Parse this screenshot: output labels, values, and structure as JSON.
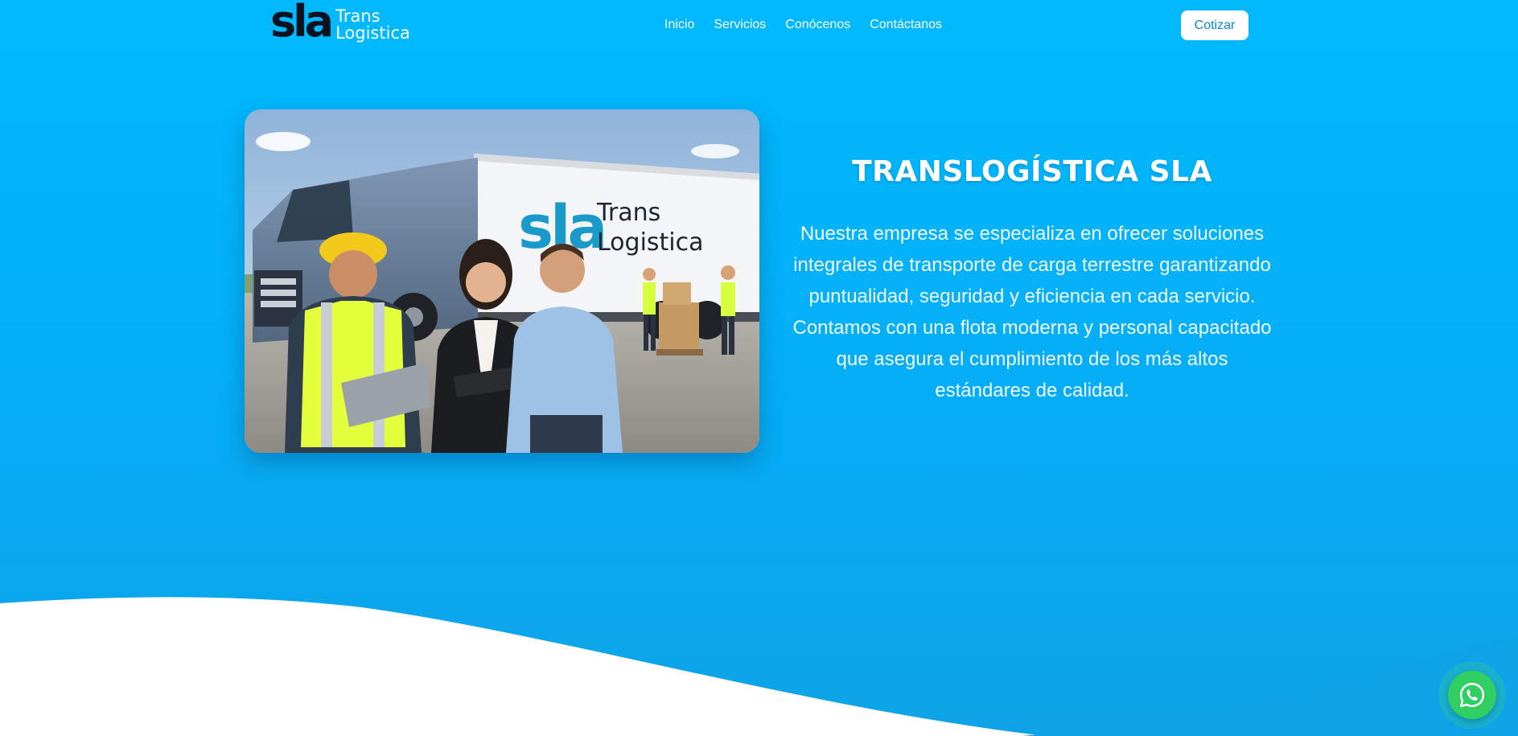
{
  "brand": {
    "logo_mark": "sla",
    "logo_word_1": "Trans",
    "logo_word_2": "Logistica"
  },
  "nav": {
    "items": [
      {
        "label": "Inicio"
      },
      {
        "label": "Servicios"
      },
      {
        "label": "Conócenos"
      },
      {
        "label": "Contáctanos"
      }
    ],
    "cta_label": "Cotizar"
  },
  "hero": {
    "title": "TRANSLOGÍSTICA SLA",
    "paragraph": "Nuestra empresa se especializa en ofrecer soluciones integrales de transporte de carga terrestre garantizando puntualidad, seguridad y eficiencia en cada servicio. Contamos con una flota moderna y personal capacitado que asegura el cumplimiento de los más altos estándares de calidad.",
    "photo": {
      "trailer_logo_mark": "sla",
      "trailer_logo_word_1": "Trans",
      "trailer_logo_word_2": "Logistica"
    }
  },
  "colors": {
    "hero_top": "#00b9fd",
    "hero_bottom": "#0ea3e6",
    "cta_text": "#0788d0",
    "whatsapp": "#2fcf63"
  },
  "icons": {
    "floating_button": "whatsapp-icon"
  }
}
